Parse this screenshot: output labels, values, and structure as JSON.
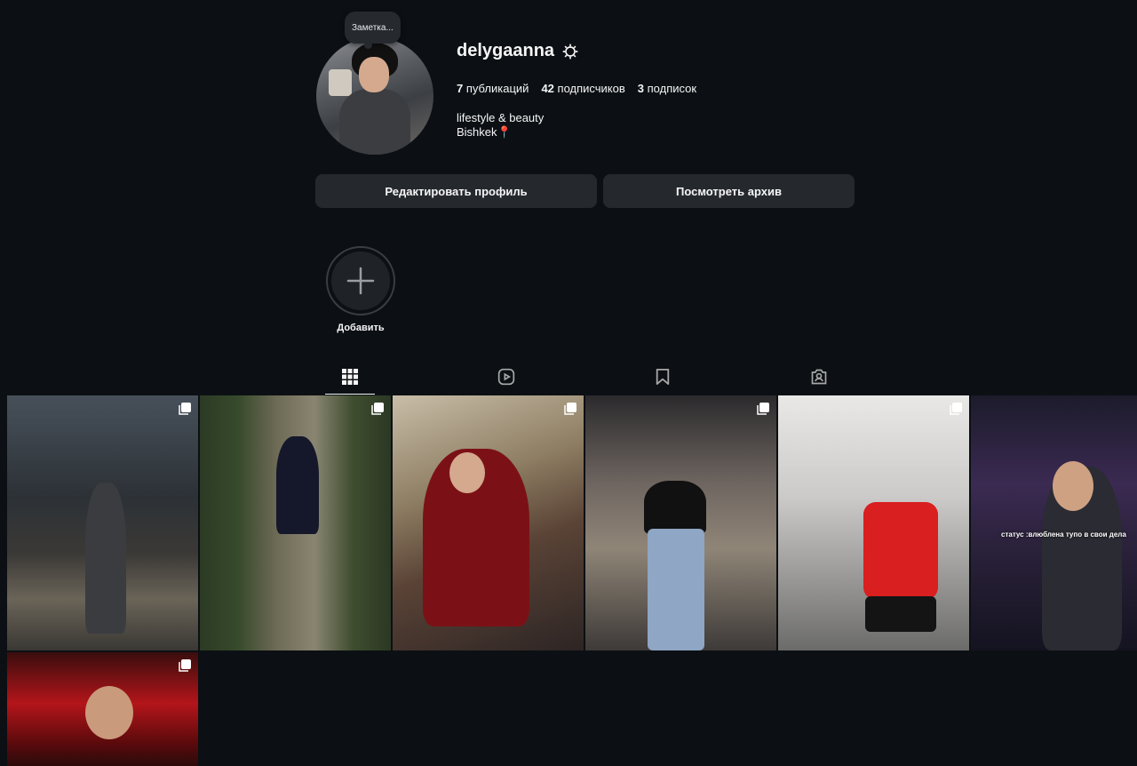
{
  "profile": {
    "note": "Заметка...",
    "username": "delygaanna",
    "stats": {
      "posts_count": "7",
      "posts_label": "публикаций",
      "followers_count": "42",
      "followers_label": "подписчиков",
      "following_count": "3",
      "following_label": "подписок"
    },
    "bio_line1": "lifestyle & beauty",
    "bio_line2": "Bishkek📍"
  },
  "actions": {
    "edit_label": "Редактировать профиль",
    "archive_label": "Посмотреть архив"
  },
  "highlights": {
    "add_label": "Добавить"
  },
  "tabs": [
    {
      "icon": "grid-icon",
      "active": true
    },
    {
      "icon": "reels-icon",
      "active": false
    },
    {
      "icon": "bookmark-icon",
      "active": false
    },
    {
      "icon": "tagged-icon",
      "active": false
    }
  ],
  "posts": [
    {
      "icon": "carousel-icon"
    },
    {
      "icon": "carousel-icon"
    },
    {
      "icon": "carousel-icon"
    },
    {
      "icon": "carousel-icon"
    },
    {
      "icon": "carousel-icon"
    },
    {
      "caption_overlay": "статус :влюблена тупо в свои дела"
    },
    {
      "icon": "carousel-icon"
    }
  ],
  "colors": {
    "background": "#0c1014",
    "button": "#25292e",
    "text": "#f5f5f5"
  }
}
